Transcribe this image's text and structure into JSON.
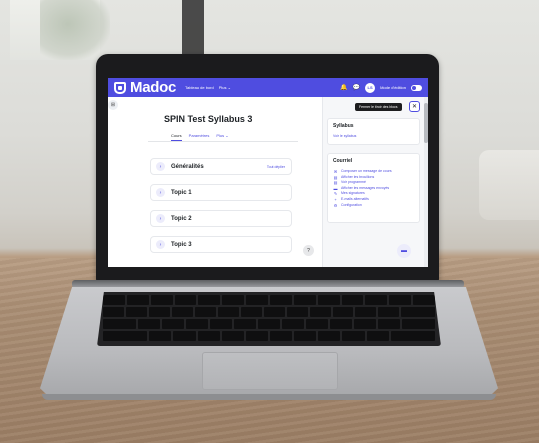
{
  "app": {
    "logo": "Madoc",
    "nav_links": [
      "Tableau de bord",
      "Plus ⌄"
    ],
    "avatar_initials": "LS",
    "edit_mode_label": "Mode d'édition",
    "accent_color": "#4f4de0"
  },
  "course": {
    "title": "SPIN Test Syllabus 3",
    "tabs": [
      "Cours",
      "Paramètres",
      "Plus ⌄"
    ],
    "sections": [
      {
        "name": "Généralités",
        "action": "Tout déplier"
      },
      {
        "name": "Topic 1",
        "action": ""
      },
      {
        "name": "Topic 2",
        "action": ""
      },
      {
        "name": "Topic 3",
        "action": ""
      }
    ]
  },
  "drawer": {
    "close_tooltip": "Fermer le tiroir des blocs",
    "syllabus": {
      "title": "Syllabus",
      "link": "Voir le syllabus"
    },
    "courriel": {
      "title": "Courriel",
      "items": [
        {
          "icon": "✉",
          "label": "Composer un message de cours"
        },
        {
          "icon": "▤",
          "label": "Afficher les brouillons"
        },
        {
          "icon": "▤",
          "label": "Voir programmé"
        },
        {
          "icon": "▬",
          "label": "Afficher les messages envoyés"
        },
        {
          "icon": "✎",
          "label": "Mes signatures"
        },
        {
          "icon": "+",
          "label": "E-mails alternatifs"
        },
        {
          "icon": "⚙",
          "label": "Configuration"
        }
      ]
    }
  },
  "icons": {
    "bell": "🔔",
    "message": "💬",
    "help": "?",
    "drawer_toggle": "⊞",
    "close": "✕",
    "chevron": "›",
    "chat": "▬"
  }
}
